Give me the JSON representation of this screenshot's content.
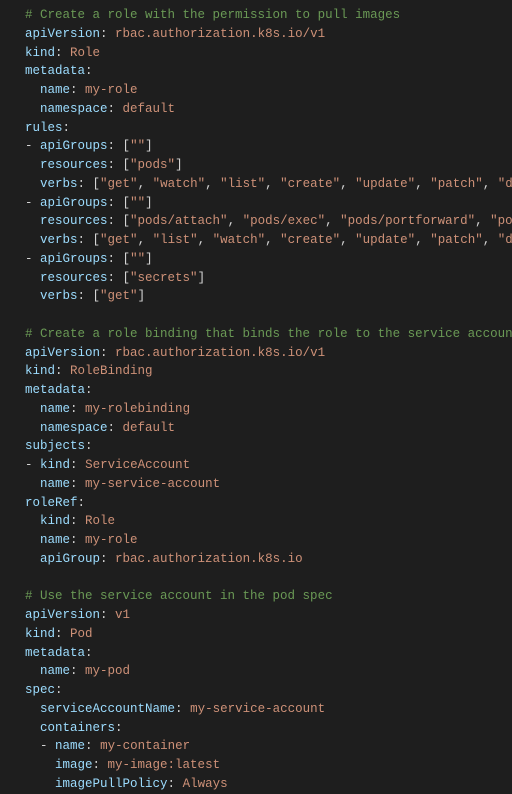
{
  "lines": [
    {
      "type": "comment",
      "indent": 1,
      "text": "# Create a role with the permission to pull images"
    },
    {
      "type": "kv",
      "indent": 1,
      "key": "apiVersion",
      "value": "rbac.authorization.k8s.io/v1"
    },
    {
      "type": "kv",
      "indent": 1,
      "key": "kind",
      "value": "Role"
    },
    {
      "type": "key",
      "indent": 1,
      "key": "metadata"
    },
    {
      "type": "kv",
      "indent": 2,
      "key": "name",
      "value": "my-role"
    },
    {
      "type": "kv",
      "indent": 2,
      "key": "namespace",
      "value": "default"
    },
    {
      "type": "key",
      "indent": 1,
      "key": "rules"
    },
    {
      "type": "dash-kv-array",
      "indent": 1,
      "key": "apiGroups",
      "values": [
        "\"\""
      ]
    },
    {
      "type": "kv-array",
      "indent": 2,
      "key": "resources",
      "values": [
        "\"pods\""
      ]
    },
    {
      "type": "kv-array",
      "indent": 2,
      "key": "verbs",
      "values": [
        "\"get\"",
        "\"watch\"",
        "\"list\"",
        "\"create\"",
        "\"update\"",
        "\"patch\"",
        "\"delete\""
      ]
    },
    {
      "type": "dash-kv-array",
      "indent": 1,
      "key": "apiGroups",
      "values": [
        "\"\""
      ]
    },
    {
      "type": "kv-array",
      "indent": 2,
      "key": "resources",
      "values": [
        "\"pods/attach\"",
        "\"pods/exec\"",
        "\"pods/portforward\"",
        "\"pods/proxy\""
      ]
    },
    {
      "type": "kv-array",
      "indent": 2,
      "key": "verbs",
      "values": [
        "\"get\"",
        "\"list\"",
        "\"watch\"",
        "\"create\"",
        "\"update\"",
        "\"patch\"",
        "\"delete\""
      ]
    },
    {
      "type": "dash-kv-array",
      "indent": 1,
      "key": "apiGroups",
      "values": [
        "\"\""
      ]
    },
    {
      "type": "kv-array",
      "indent": 2,
      "key": "resources",
      "values": [
        "\"secrets\""
      ]
    },
    {
      "type": "kv-array",
      "indent": 2,
      "key": "verbs",
      "values": [
        "\"get\""
      ]
    },
    {
      "type": "blank"
    },
    {
      "type": "comment",
      "indent": 1,
      "text": "# Create a role binding that binds the role to the service account"
    },
    {
      "type": "kv",
      "indent": 1,
      "key": "apiVersion",
      "value": "rbac.authorization.k8s.io/v1"
    },
    {
      "type": "kv",
      "indent": 1,
      "key": "kind",
      "value": "RoleBinding"
    },
    {
      "type": "key",
      "indent": 1,
      "key": "metadata"
    },
    {
      "type": "kv",
      "indent": 2,
      "key": "name",
      "value": "my-rolebinding"
    },
    {
      "type": "kv",
      "indent": 2,
      "key": "namespace",
      "value": "default"
    },
    {
      "type": "key",
      "indent": 1,
      "key": "subjects"
    },
    {
      "type": "dash-kv",
      "indent": 1,
      "key": "kind",
      "value": "ServiceAccount"
    },
    {
      "type": "kv",
      "indent": 2,
      "key": "name",
      "value": "my-service-account"
    },
    {
      "type": "key",
      "indent": 1,
      "key": "roleRef"
    },
    {
      "type": "kv",
      "indent": 2,
      "key": "kind",
      "value": "Role"
    },
    {
      "type": "kv",
      "indent": 2,
      "key": "name",
      "value": "my-role"
    },
    {
      "type": "kv",
      "indent": 2,
      "key": "apiGroup",
      "value": "rbac.authorization.k8s.io"
    },
    {
      "type": "blank"
    },
    {
      "type": "comment",
      "indent": 1,
      "text": "# Use the service account in the pod spec"
    },
    {
      "type": "kv",
      "indent": 1,
      "key": "apiVersion",
      "value": "v1"
    },
    {
      "type": "kv",
      "indent": 1,
      "key": "kind",
      "value": "Pod"
    },
    {
      "type": "key",
      "indent": 1,
      "key": "metadata"
    },
    {
      "type": "kv",
      "indent": 2,
      "key": "name",
      "value": "my-pod"
    },
    {
      "type": "key",
      "indent": 1,
      "key": "spec"
    },
    {
      "type": "kv",
      "indent": 2,
      "key": "serviceAccountName",
      "value": "my-service-account"
    },
    {
      "type": "key",
      "indent": 2,
      "key": "containers"
    },
    {
      "type": "dash-kv",
      "indent": 2,
      "key": "name",
      "value": "my-container"
    },
    {
      "type": "kv",
      "indent": 3,
      "key": "image",
      "value": "my-image:latest"
    },
    {
      "type": "kv",
      "indent": 3,
      "key": "imagePullPolicy",
      "value": "Always"
    }
  ]
}
